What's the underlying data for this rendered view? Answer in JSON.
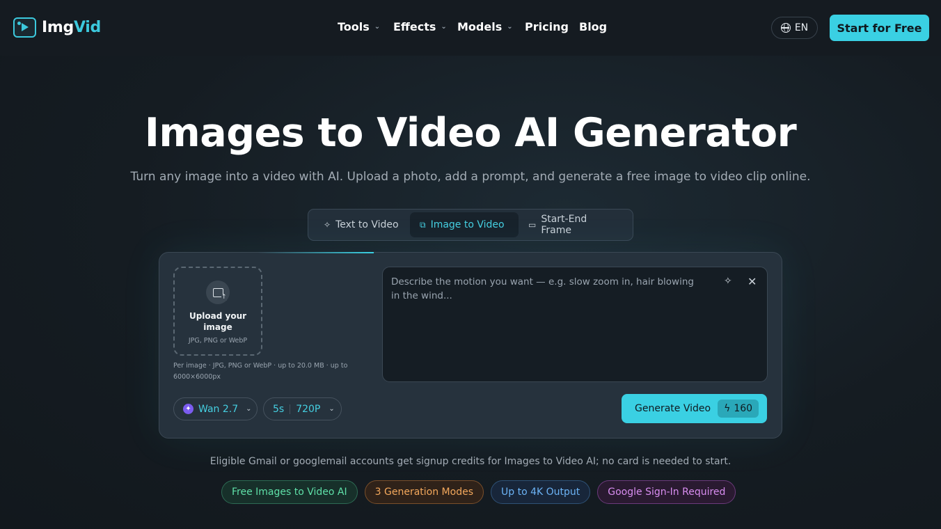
{
  "header": {
    "logo_text_a": "Img",
    "logo_text_b": "Vid",
    "nav": [
      {
        "label": "Tools",
        "has_menu": true
      },
      {
        "label": "Effects",
        "has_menu": true
      },
      {
        "label": "Models",
        "has_menu": true
      },
      {
        "label": "Pricing",
        "has_menu": false
      },
      {
        "label": "Blog",
        "has_menu": false
      }
    ],
    "language": "EN",
    "cta_label": "Start for Free"
  },
  "hero": {
    "title": "Images to Video AI Generator",
    "subtitle": "Turn any image into a video with AI. Upload a photo, add a prompt, and generate a free image to video clip online."
  },
  "mode_tabs": [
    {
      "label": "Text to Video",
      "icon": "sparkle-icon",
      "active": false
    },
    {
      "label": "Image to Video",
      "icon": "image-copy-icon",
      "active": true
    },
    {
      "label": "Start-End Frame",
      "icon": "video-camera-icon",
      "active": false
    }
  ],
  "upload": {
    "title": "Upload your image",
    "formats": "JPG, PNG or WebP",
    "note": "Per image · JPG, PNG or WebP · up to 20.0 MB · up to 6000×6000px"
  },
  "prompt": {
    "placeholder": "Describe the motion you want — e.g. slow zoom in, hair blowing in the wind..."
  },
  "settings": {
    "model": "Wan 2.7",
    "duration": "5s",
    "resolution": "720P"
  },
  "generate": {
    "label": "Generate Video",
    "credits": "160"
  },
  "footer_note": "Eligible Gmail or googlemail accounts get signup credits for Images to Video AI; no card is needed to start.",
  "badges": [
    {
      "label": "Free Images to Video AI",
      "color": "#5fe0a8"
    },
    {
      "label": "3 Generation Modes",
      "color": "#f3a85c"
    },
    {
      "label": "Up to 4K Output",
      "color": "#6cb3f5"
    },
    {
      "label": "Google Sign-In Required",
      "color": "#d88df0"
    }
  ],
  "colors": {
    "accent": "#3ad0e3",
    "background": "#151c22"
  }
}
